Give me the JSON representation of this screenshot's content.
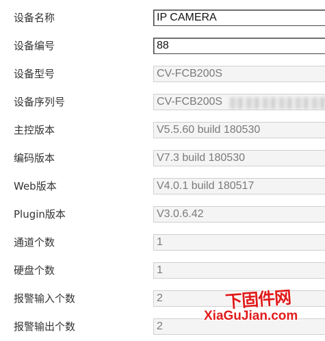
{
  "fields": [
    {
      "label": "设备名称",
      "value": "IP CAMERA"
    },
    {
      "label": "设备编号",
      "value": "88"
    },
    {
      "label": "设备型号",
      "value": "CV-FCB200S"
    },
    {
      "label": "设备序列号",
      "value": "CV-FCB200S"
    },
    {
      "label": "主控版本",
      "value": "V5.5.60 build 180530"
    },
    {
      "label": "编码版本",
      "value": "V7.3 build 180530"
    },
    {
      "label": "Web版本",
      "value": "V4.0.1 build 180517"
    },
    {
      "label": "Plugin版本",
      "value": "V3.0.6.42"
    },
    {
      "label": "通道个数",
      "value": "1"
    },
    {
      "label": "硬盘个数",
      "value": "1"
    },
    {
      "label": "报警输入个数",
      "value": "2"
    },
    {
      "label": "报警输出个数",
      "value": "2"
    }
  ],
  "watermark": {
    "cn": "下固件网",
    "en": "XiaGuJian.com"
  }
}
